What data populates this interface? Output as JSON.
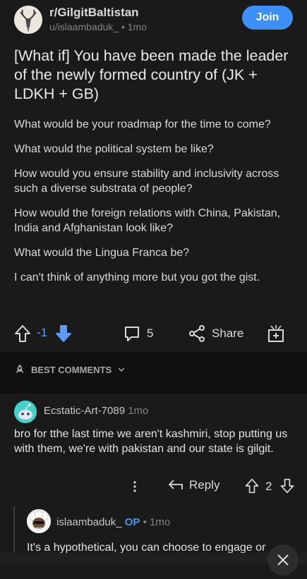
{
  "post": {
    "subreddit": "r/GilgitBaltistan",
    "author": "u/islaambaduk_",
    "age": "1mo",
    "join_label": "Join",
    "title": "[What if] You have been made the leader of the newly formed country of (JK + LDKH + GB)",
    "paragraphs": [
      "What would be your roadmap for the time to come?",
      "What would the political system be like?",
      "How would you ensure stability and inclusivity across such a diverse substrata of people?",
      "How would the foreign relations with China, Pakistan, India and Afghanistan look like?",
      "What would the Lingua Franca be?",
      "I can't think of anything more but you got the gist."
    ],
    "score": "-1",
    "comment_count": "5",
    "share_label": "Share",
    "upvote_icon": "upvote-arrow-icon",
    "downvote_icon": "downvote-arrow-icon",
    "accent_color": "#3c8ff7"
  },
  "sort": {
    "label": "BEST COMMENTS"
  },
  "comments": [
    {
      "author": "Ecstatic-Art-7089",
      "age": "1mo",
      "text": "bro for tthe last time we aren't kashmiri, stop putting us with them, we're with pakistan and our state is gilgit.",
      "reply_label": "Reply",
      "score": "2"
    },
    {
      "author": "islaambaduk_",
      "op_badge": "OP",
      "age": "1mo",
      "text": "It's a hypothetical, you can choose to engage or"
    }
  ]
}
